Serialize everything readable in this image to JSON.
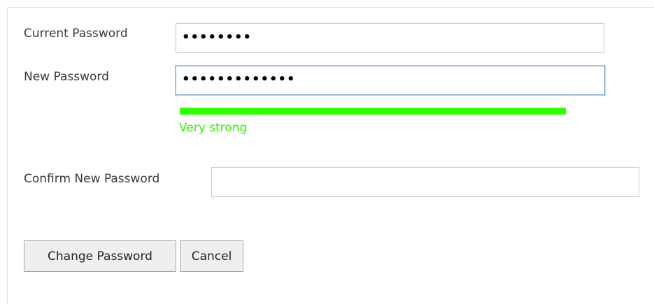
{
  "form": {
    "current_password": {
      "label": "Current Password",
      "masked_value": "••••••••"
    },
    "new_password": {
      "label": "New Password",
      "masked_value": "•••••••••••••"
    },
    "strength": {
      "text": "Very strong",
      "level": 1.0,
      "color": "#33ff00"
    },
    "confirm_password": {
      "label": "Confirm New Password",
      "masked_value": ""
    },
    "buttons": {
      "change_password": "Change Password",
      "cancel": "Cancel"
    }
  }
}
